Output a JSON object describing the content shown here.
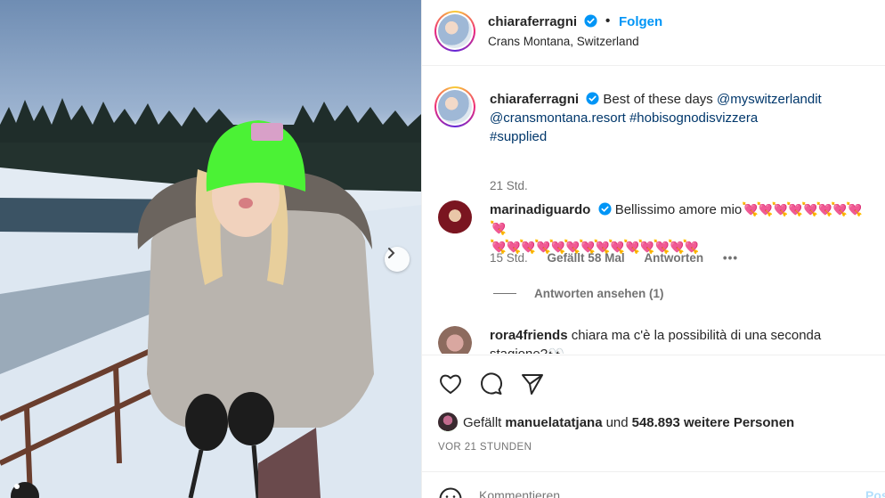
{
  "post": {
    "author": "chiaraferragni",
    "verified_icon": "verified-badge-icon",
    "separator": "•",
    "follow_label": "Folgen",
    "location": "Crans Montana, Switzerland"
  },
  "caption": {
    "author": "chiaraferragni",
    "text": "Best of these days",
    "mention1": "@myswitzerlandit",
    "mention2": "@cransmontana.resort",
    "hashtag1": "#hobisognodisvizzera",
    "hashtag2": "#supplied",
    "age": "21 Std."
  },
  "comments": [
    {
      "author": "marinadiguardo",
      "text": "Bellissimo amore mio",
      "hearts_line1": "💘💘💘💘💘💘💘💘💘",
      "hearts_line2": "💘💘💘💘💘💘💘💘💘💘💘💘💘💘",
      "age": "15 Std.",
      "likes": "Gefällt 58 Mal",
      "reply": "Antworten",
      "more": "•••",
      "view_replies": "Antworten ansehen (1)"
    },
    {
      "author": "rora4friends",
      "text": "chiara ma c'è la possibilità di una seconda stagione?👀"
    }
  ],
  "actions": {
    "like_icon": "heart-icon",
    "comment_icon": "comment-icon",
    "share_icon": "share-icon"
  },
  "likes": {
    "prefix": "Gefällt",
    "user": "manuelatatjana",
    "middle": "und",
    "count": "548.893 weitere Personen"
  },
  "timestamp": "VOR 21 STUNDEN",
  "add_comment": {
    "placeholder": "Kommentieren ...",
    "post_label": "Posten"
  },
  "colors": {
    "follow_blue": "#0095f6",
    "verified_blue": "#0095f6",
    "link_navy": "#00376b",
    "muted_gray": "#737373"
  }
}
